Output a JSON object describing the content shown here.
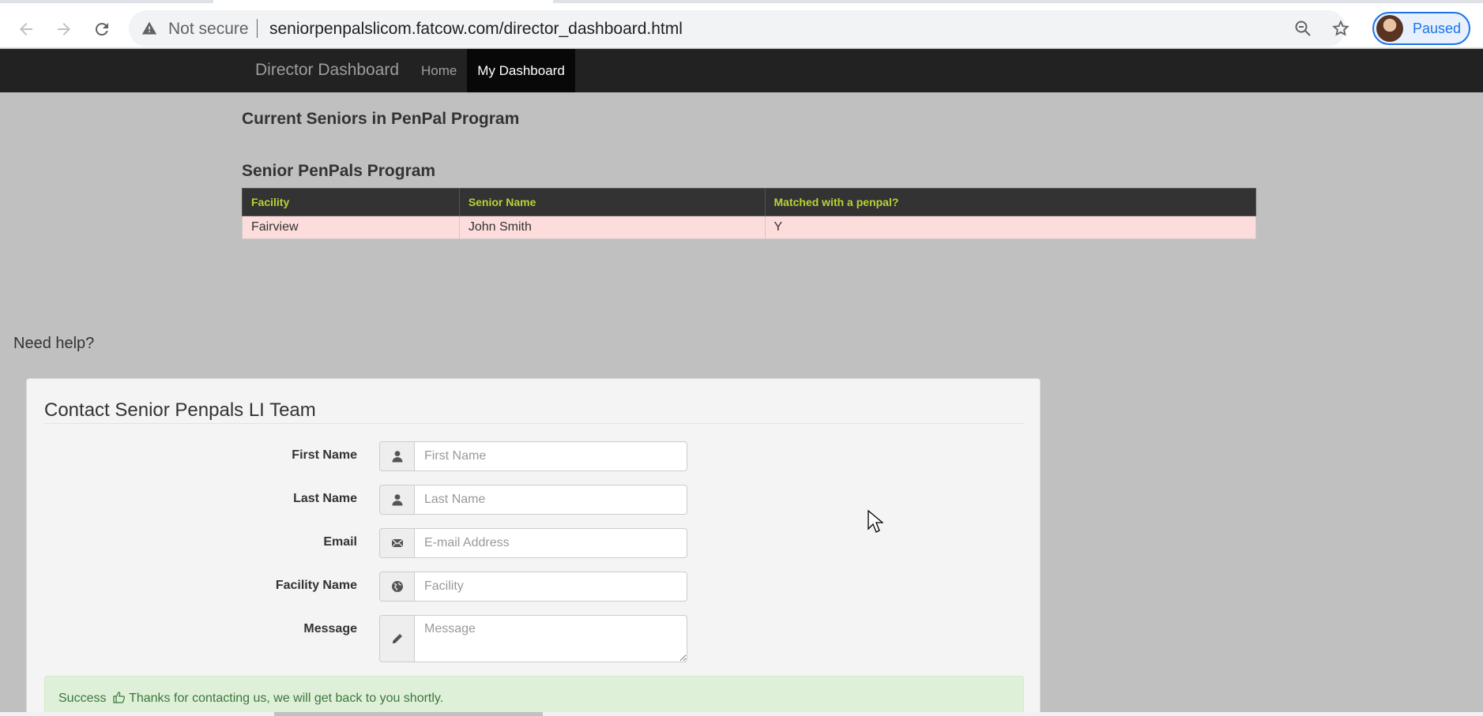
{
  "browser": {
    "security_label": "Not secure",
    "url": "seniorpenpalslicom.fatcow.com/director_dashboard.html",
    "profile_label": "Paused"
  },
  "navbar": {
    "brand": "Director Dashboard",
    "links": [
      "Home",
      "My Dashboard"
    ],
    "active_link": "My Dashboard"
  },
  "main": {
    "heading": "Current Seniors in PenPal Program",
    "table_title": "Senior PenPals Program",
    "table": {
      "columns": [
        "Facility",
        "Senior Name",
        "Matched with a penpal?"
      ],
      "rows": [
        [
          "Fairview",
          "John Smith",
          "Y"
        ]
      ]
    }
  },
  "help": {
    "text": "Need help?"
  },
  "contact": {
    "title": "Contact Senior Penpals LI Team",
    "fields": [
      {
        "label": "First Name",
        "placeholder": "First Name",
        "icon": "user-icon",
        "value": ""
      },
      {
        "label": "Last Name",
        "placeholder": "Last Name",
        "icon": "user-icon",
        "value": ""
      },
      {
        "label": "Email",
        "placeholder": "E-mail Address",
        "icon": "envelope-icon",
        "value": ""
      },
      {
        "label": "Facility Name",
        "placeholder": "Facility",
        "icon": "globe-icon",
        "value": ""
      },
      {
        "label": "Message",
        "placeholder": "Message",
        "icon": "pencil-icon",
        "value": ""
      }
    ],
    "alert": {
      "strong": "Success",
      "text": " Thanks for contacting us, we will get back to you shortly.",
      "icon": "thumbs-up-icon"
    }
  },
  "colors": {
    "navbar_bg": "#222222",
    "page_bg": "#c0c0c0",
    "table_header_bg": "#333333",
    "table_header_text": "#b5d336",
    "table_row_bg": "#fddcdc",
    "alert_bg": "#dff0d8",
    "alert_text": "#3c763d",
    "accent": "#1a73e8"
  }
}
